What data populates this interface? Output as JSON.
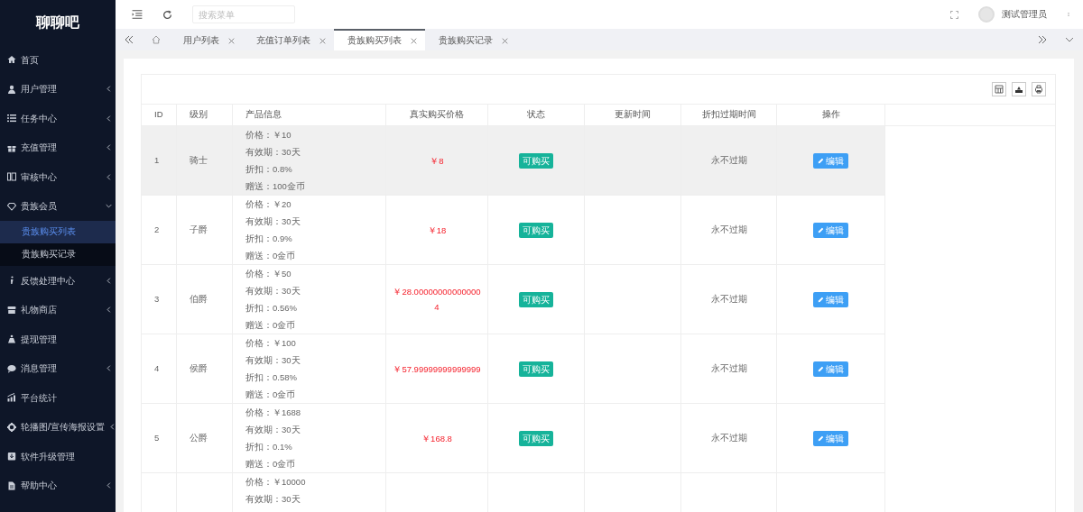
{
  "sidebar": {
    "logo": "聊聊吧",
    "items": [
      {
        "label": "首页"
      },
      {
        "label": "用户管理",
        "expanded": false
      },
      {
        "label": "任务中心",
        "expanded": false
      },
      {
        "label": "充值管理",
        "expanded": false
      },
      {
        "label": "审核中心",
        "expanded": false
      },
      {
        "label": "贵族会员",
        "expanded": true,
        "children": [
          {
            "label": "贵族购买列表",
            "selected": true
          },
          {
            "label": "贵族购买记录",
            "selected": false
          }
        ]
      },
      {
        "label": "反馈处理中心",
        "expanded": false
      },
      {
        "label": "礼物商店",
        "expanded": false
      },
      {
        "label": "提现管理"
      },
      {
        "label": "消息管理",
        "expanded": false
      },
      {
        "label": "平台统计"
      },
      {
        "label": "轮播图/宣传海报设置",
        "expanded": false
      },
      {
        "label": "软件升级管理"
      },
      {
        "label": "帮助中心",
        "expanded": false
      }
    ]
  },
  "header": {
    "search": {
      "placeholder": "搜索菜单"
    },
    "user": "测试管理员"
  },
  "tabs": [
    {
      "label": "用户列表",
      "selected": false
    },
    {
      "label": "充值订单列表",
      "selected": false
    },
    {
      "label": "贵族购买列表",
      "selected": true
    },
    {
      "label": "贵族购买记录",
      "selected": false
    }
  ],
  "table": {
    "columns": [
      "ID",
      "级别",
      "产品信息",
      "真实购买价格",
      "状态",
      "更新时间",
      "折扣过期时间",
      "操作"
    ],
    "rows": [
      {
        "id": "1",
        "level": "骑士",
        "info": [
          "价格：￥10",
          "有效期：30天",
          "折扣：0.8%",
          "赠送：100金币"
        ],
        "price": "￥8",
        "status": "可购买",
        "expire": "永不过期",
        "action": "编辑",
        "hovered": true
      },
      {
        "id": "2",
        "level": "子爵",
        "info": [
          "价格：￥20",
          "有效期：30天",
          "折扣：0.9%",
          "赠送：0金币"
        ],
        "price": "￥18",
        "status": "可购买",
        "expire": "永不过期",
        "action": "编辑",
        "hovered": false
      },
      {
        "id": "3",
        "level": "伯爵",
        "info": [
          "价格：￥50",
          "有效期：30天",
          "折扣：0.56%",
          "赠送：0金币"
        ],
        "price": "￥28.000000000000004",
        "status": "可购买",
        "expire": "永不过期",
        "action": "编辑",
        "hovered": false
      },
      {
        "id": "4",
        "level": "侯爵",
        "info": [
          "价格：￥100",
          "有效期：30天",
          "折扣：0.58%",
          "赠送：0金币"
        ],
        "price": "￥57.99999999999999",
        "status": "可购买",
        "expire": "永不过期",
        "action": "编辑",
        "hovered": false
      },
      {
        "id": "5",
        "level": "公爵",
        "info": [
          "价格：￥1688",
          "有效期：30天",
          "折扣：0.1%",
          "赠送：0金币"
        ],
        "price": "￥168.8",
        "status": "可购买",
        "expire": "永不过期",
        "action": "编辑",
        "hovered": false
      },
      {
        "info": [
          "价格：￥10000",
          "有效期：30天"
        ],
        "hovered": false
      }
    ]
  }
}
